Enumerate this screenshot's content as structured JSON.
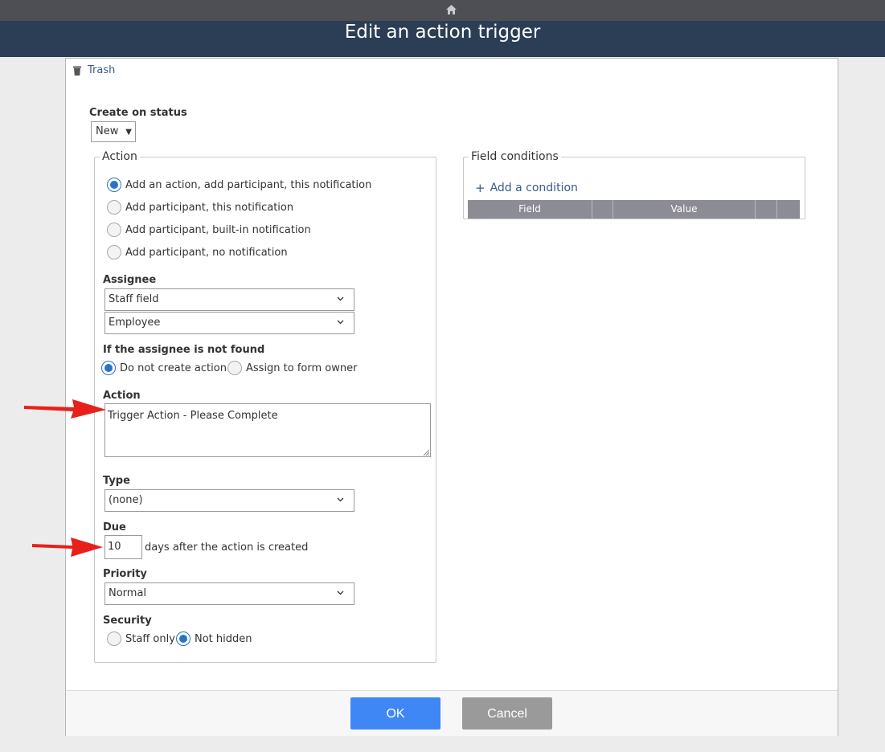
{
  "window": {
    "title": "Edit an action trigger",
    "home_icon": "home-icon"
  },
  "toolbar": {
    "trash_label": "Trash",
    "trash_icon": "trash-icon"
  },
  "create_on_status": {
    "label": "Create on status",
    "value": "New"
  },
  "action_fieldset": {
    "legend": "Action",
    "action_options": [
      {
        "label": "Add an action, add participant, this notification",
        "checked": true
      },
      {
        "label": "Add participant, this notification",
        "checked": false
      },
      {
        "label": "Add participant, built-in notification",
        "checked": false
      },
      {
        "label": "Add participant, no notification",
        "checked": false
      }
    ],
    "assignee": {
      "label": "Assignee",
      "source_value": "Staff field",
      "field_value": "Employee"
    },
    "not_found": {
      "label": "If the assignee is not found",
      "options": [
        {
          "label": "Do not create action",
          "checked": true
        },
        {
          "label": "Assign to form owner",
          "checked": false
        }
      ]
    },
    "action_text": {
      "label": "Action",
      "value": "Trigger Action - Please Complete"
    },
    "type": {
      "label": "Type",
      "value": "(none)"
    },
    "due": {
      "label": "Due",
      "value": "10",
      "suffix": "days after the action is created"
    },
    "priority": {
      "label": "Priority",
      "value": "Normal"
    },
    "security": {
      "label": "Security",
      "options": [
        {
          "label": "Staff only",
          "checked": false
        },
        {
          "label": "Not hidden",
          "checked": true
        }
      ]
    }
  },
  "field_conditions": {
    "legend": "Field conditions",
    "add_label": "Add a condition",
    "columns": [
      "Field",
      "",
      "Value",
      "",
      ""
    ]
  },
  "footer": {
    "ok_label": "OK",
    "cancel_label": "Cancel"
  },
  "colors": {
    "header": "#2b3e55",
    "link": "#3a5a8a",
    "ok_button": "#3e87f5",
    "cancel_button": "#9a9a9a",
    "arrow": "#e8201a"
  }
}
